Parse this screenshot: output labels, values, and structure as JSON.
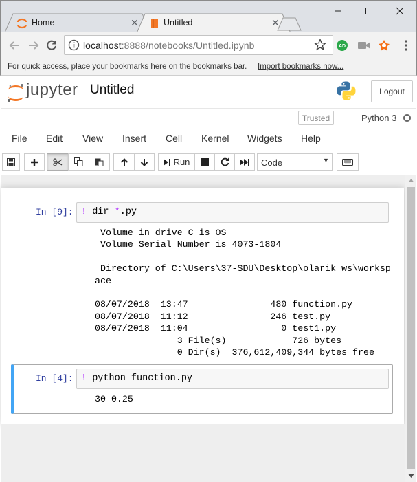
{
  "browser": {
    "tabs": [
      {
        "label": "Home"
      },
      {
        "label": "Untitled"
      }
    ],
    "url_host": "localhost",
    "url_rest": ":8888/notebooks/Untitled.ipynb",
    "extension_badge": "AD",
    "bookmarks_message": "For quick access, place your bookmarks here on the bookmarks bar.",
    "bookmarks_link": "Import bookmarks now..."
  },
  "header": {
    "logo_text": "jupyter",
    "notebook_name": "Untitled",
    "logout_label": "Logout",
    "trusted_label": "Trusted",
    "kernel_name": "Python 3"
  },
  "menu": {
    "file": "File",
    "edit": "Edit",
    "view": "View",
    "insert": "Insert",
    "cell": "Cell",
    "kernel": "Kernel",
    "widgets": "Widgets",
    "help": "Help"
  },
  "toolbar": {
    "run_label": "Run",
    "cell_type": "Code"
  },
  "cells": [
    {
      "prompt": "In [9]:",
      "bang": "!",
      "code_cmd": " dir ",
      "code_op": "*",
      "code_rest": ".py",
      "output": " Volume in drive C is OS\n Volume Serial Number is 4073-1804\n\n Directory of C:\\Users\\37-SDU\\Desktop\\olarik_ws\\worksp\nace\n\n08/07/2018  13:47               480 function.py\n08/07/2018  11:12               246 test.py\n08/07/2018  11:04                 0 test1.py\n               3 File(s)            726 bytes\n               0 Dir(s)  376,612,409,344 bytes free"
    },
    {
      "prompt": "In [4]:",
      "bang": "!",
      "code": " python function.py",
      "output": "30 0.25"
    }
  ],
  "colors": {
    "selected_cell_accent": "#42a5f5",
    "prompt": "#303f9f",
    "jupyter_orange": "#f37726"
  }
}
